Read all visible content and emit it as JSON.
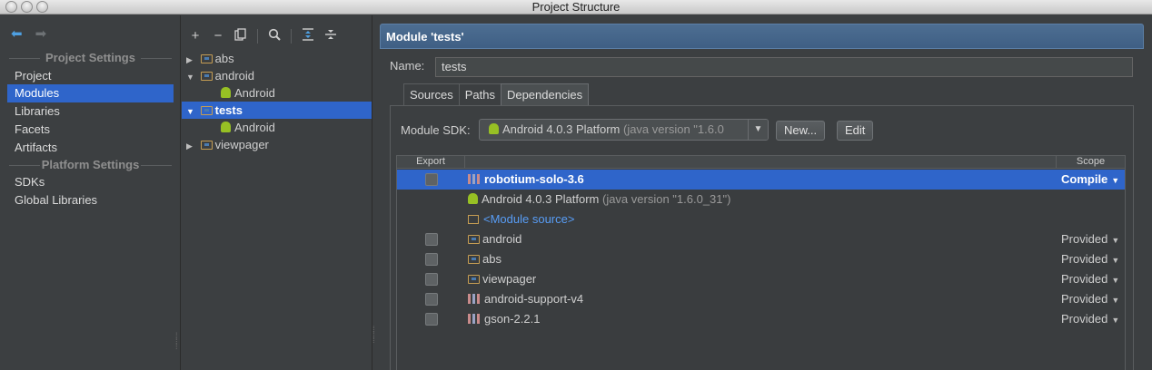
{
  "window": {
    "title": "Project Structure"
  },
  "nav": {
    "back_icon": "arrow-left-icon",
    "forward_icon": "arrow-right-icon"
  },
  "left_panel": {
    "project_settings_title": "Project Settings",
    "project_settings_items": [
      "Project",
      "Modules",
      "Libraries",
      "Facets",
      "Artifacts"
    ],
    "selected_item": "Modules",
    "platform_settings_title": "Platform Settings",
    "platform_settings_items": [
      "SDKs",
      "Global Libraries"
    ]
  },
  "tree_toolbar": {
    "add": "+",
    "remove": "−",
    "copy_icon": "copy-icon",
    "search_icon": "search-icon",
    "expand_icon": "expand-all-icon",
    "collapse_icon": "collapse-all-icon"
  },
  "tree": [
    {
      "label": "abs",
      "level": 0,
      "expanded": false,
      "icon": "module-folder-icon"
    },
    {
      "label": "android",
      "level": 0,
      "expanded": true,
      "icon": "module-folder-icon"
    },
    {
      "label": "Android",
      "level": 1,
      "icon": "android-icon"
    },
    {
      "label": "tests",
      "level": 0,
      "expanded": true,
      "icon": "module-folder-icon",
      "selected": true
    },
    {
      "label": "Android",
      "level": 1,
      "icon": "android-icon"
    },
    {
      "label": "viewpager",
      "level": 0,
      "expanded": false,
      "icon": "module-folder-icon"
    }
  ],
  "module_header": "Module 'tests'",
  "name_field": {
    "label": "Name:",
    "value": "tests"
  },
  "tabs": [
    "Sources",
    "Paths",
    "Dependencies"
  ],
  "active_tab": "Dependencies",
  "module_sdk": {
    "label": "Module SDK:",
    "value": "Android 4.0.3 Platform",
    "detail": "(java version \"1.6.0",
    "new_button": "New...",
    "edit_button": "Edit"
  },
  "dependencies_table": {
    "columns": {
      "export": "Export",
      "scope": "Scope"
    },
    "rows": [
      {
        "name": "robotium-solo-3.6",
        "detail": "",
        "icon": "library-icon",
        "checkbox": true,
        "scope": "Compile",
        "selected": true
      },
      {
        "name": "Android 4.0.3 Platform",
        "detail": "(java version \"1.6.0_31\")",
        "icon": "android-icon",
        "checkbox": false,
        "scope": ""
      },
      {
        "name": "<Module source>",
        "detail": "",
        "icon": "source-folder-icon",
        "checkbox": false,
        "scope": "",
        "link": true
      },
      {
        "name": "android",
        "detail": "",
        "icon": "module-folder-icon",
        "checkbox": true,
        "scope": "Provided"
      },
      {
        "name": "abs",
        "detail": "",
        "icon": "module-folder-icon",
        "checkbox": true,
        "scope": "Provided"
      },
      {
        "name": "viewpager",
        "detail": "",
        "icon": "module-folder-icon",
        "checkbox": true,
        "scope": "Provided"
      },
      {
        "name": "android-support-v4",
        "detail": "",
        "icon": "library-icon",
        "checkbox": true,
        "scope": "Provided"
      },
      {
        "name": "gson-2.2.1",
        "detail": "",
        "icon": "library-icon",
        "checkbox": true,
        "scope": "Provided"
      }
    ]
  }
}
